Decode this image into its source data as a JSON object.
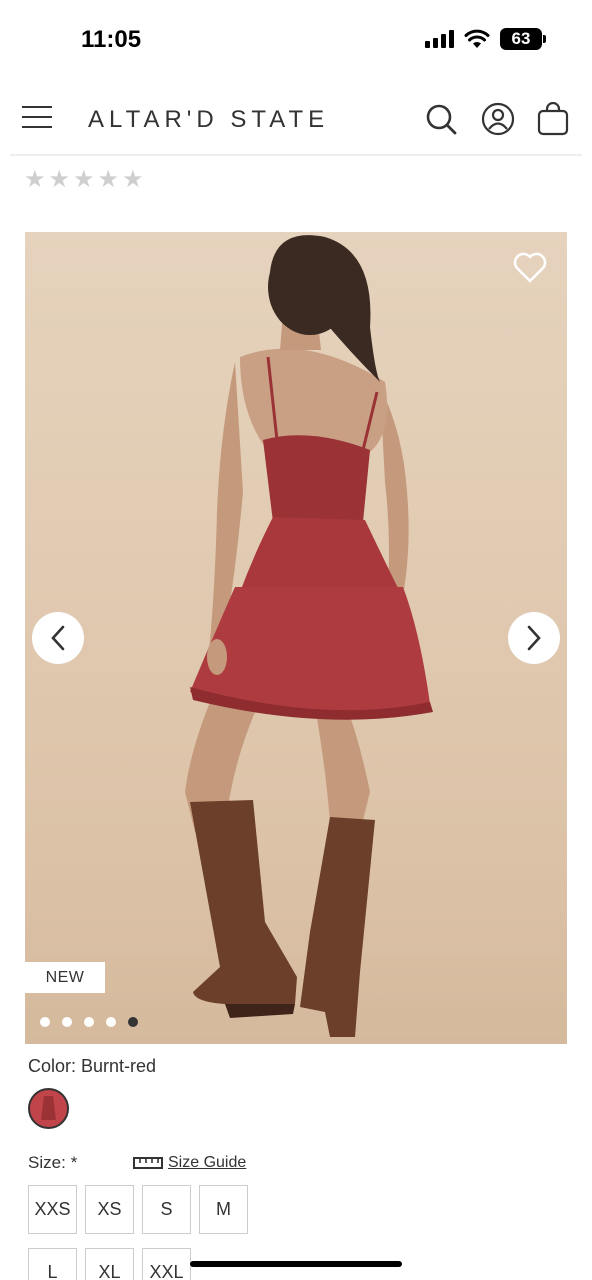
{
  "status_bar": {
    "time": "11:05",
    "battery": "63",
    "icons": [
      "signal-icon",
      "wifi-icon",
      "battery-icon"
    ]
  },
  "header": {
    "logo": "ALTAR'D STATE",
    "icons": [
      "menu-icon",
      "search-icon",
      "account-icon",
      "shopping-bag-icon"
    ]
  },
  "rating": {
    "stars": 5,
    "filled": 0,
    "star_glyph": "★"
  },
  "gallery": {
    "badge": "NEW",
    "total_slides": 5,
    "active_slide": 5,
    "icons": [
      "heart-icon",
      "chevron-left-icon",
      "chevron-right-icon"
    ]
  },
  "color": {
    "label": "Color:",
    "value": "Burnt-red",
    "swatch_color": "#c1444a"
  },
  "size": {
    "label": "Size:",
    "required_mark": "*",
    "guide_label": "Size Guide",
    "options": [
      "XXS",
      "XS",
      "S",
      "M",
      "L",
      "XL",
      "XXL"
    ]
  },
  "colors": {
    "text": "#333333",
    "background": "#ffffff",
    "image_background": "#e2cdb5",
    "dress": "#a8383b",
    "boots": "#6b3f2a"
  }
}
